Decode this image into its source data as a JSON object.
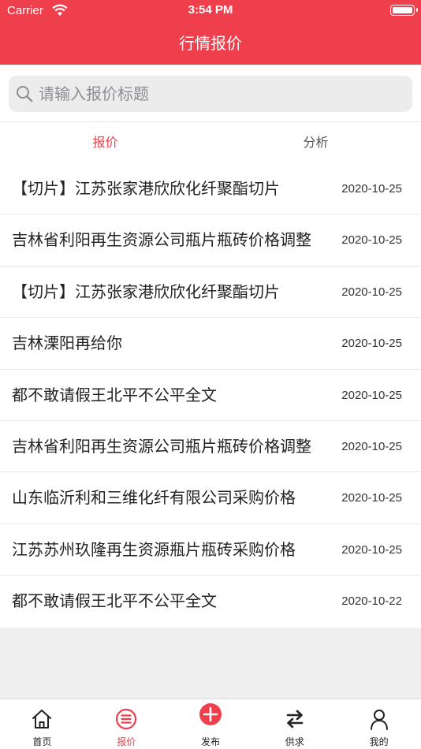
{
  "status_bar": {
    "carrier": "Carrier",
    "time": "3:54 PM"
  },
  "nav": {
    "title": "行情报价"
  },
  "search": {
    "placeholder": "请输入报价标题",
    "value": ""
  },
  "tabs": [
    {
      "label": "报价",
      "active": true
    },
    {
      "label": "分析",
      "active": false
    }
  ],
  "list": [
    {
      "title": "【切片】江苏张家港欣欣化纤聚酯切片",
      "date": "2020-10-25"
    },
    {
      "title": "吉林省利阳再生资源公司瓶片瓶砖价格调整",
      "date": "2020-10-25"
    },
    {
      "title": "【切片】江苏张家港欣欣化纤聚酯切片",
      "date": "2020-10-25"
    },
    {
      "title": "吉林溧阳再给你",
      "date": "2020-10-25"
    },
    {
      "title": "都不敢请假王北平不公平全文",
      "date": "2020-10-25"
    },
    {
      "title": "吉林省利阳再生资源公司瓶片瓶砖价格调整",
      "date": "2020-10-25"
    },
    {
      "title": "山东临沂利和三维化纤有限公司采购价格",
      "date": "2020-10-25"
    },
    {
      "title": "江苏苏州玖隆再生资源瓶片瓶砖采购价格",
      "date": "2020-10-25"
    },
    {
      "title": "都不敢请假王北平不公平全文",
      "date": "2020-10-22"
    }
  ],
  "tabbar": [
    {
      "label": "首页",
      "icon": "home-icon",
      "active": false
    },
    {
      "label": "报价",
      "icon": "list-icon",
      "active": true
    },
    {
      "label": "发布",
      "icon": "publish-plus-icon",
      "active": false
    },
    {
      "label": "供求",
      "icon": "exchange-icon",
      "active": false
    },
    {
      "label": "我的",
      "icon": "user-icon",
      "active": false
    }
  ],
  "colors": {
    "accent": "#ef3e4c",
    "background": "#efefef",
    "text": "#222222"
  }
}
